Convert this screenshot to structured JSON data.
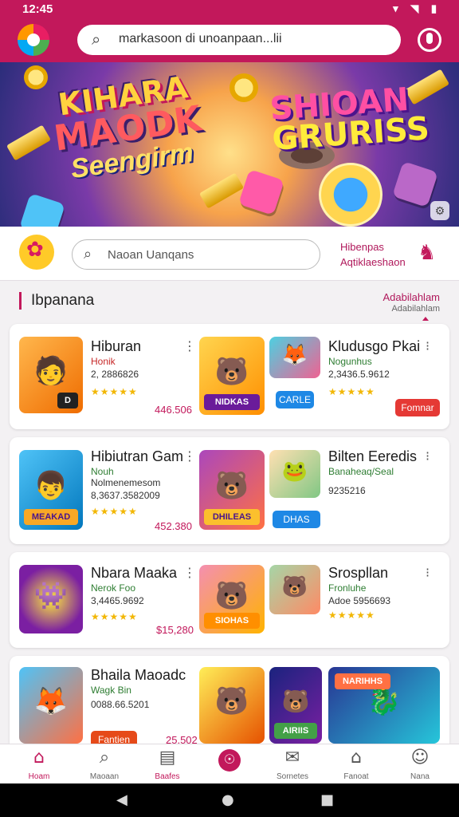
{
  "status_bar": {
    "time": "12:45",
    "icons": "▾ ◥ ▮"
  },
  "header": {
    "search_text": "markasoon di unoanpaan...lii"
  },
  "banner": {
    "left_logo": [
      "KIHARA",
      "MAODK",
      "Seengirm"
    ],
    "right_logo": [
      "SHIOAN",
      "GRURISS"
    ]
  },
  "sub_bar": {
    "search_placeholder": "Naoan Uanqans",
    "link_line1": "Hibenpas",
    "link_line2": "Aqtiklaeshaon"
  },
  "section": {
    "title": "Ibpanana",
    "link": "Adabilahlam",
    "link_sub": "Adabilahlam"
  },
  "cards": [
    {
      "left": {
        "name": "Hiburan",
        "category": "Honik",
        "meta": "2, 2886826",
        "stars": "★★★★★",
        "price": "446.506",
        "thumb_tag": "D"
      },
      "middle": {
        "thumb_tag": "NIDKAS"
      },
      "right": {
        "name": "Kludusgo Pkai",
        "category": "Nogunhus",
        "meta": "2,3436.5.9612",
        "stars": "★★★★★",
        "button": "Fomnar",
        "thumb_tag": "CARLE"
      }
    },
    {
      "left": {
        "name": "Hibiutran Gam",
        "category": "Nouh",
        "meta": "Nolmenemesom",
        "meta2": "8,3637.3582009",
        "stars": "★★★★★",
        "price": "452.380",
        "thumb_tag": "MEAKAD"
      },
      "middle": {
        "thumb_tag": "DHILEAS"
      },
      "right": {
        "name": "Bilten Eeredis",
        "category": "Banaheaq/Seal",
        "meta": "9235216",
        "button": "DHAS",
        "thumb_tag": ""
      }
    },
    {
      "left": {
        "name": "Nbara Maaka",
        "category": "Nerok Foo",
        "meta": "3,4465.9692",
        "stars": "★★★★★",
        "price": "$15,280",
        "thumb_tag": ""
      },
      "middle": {
        "thumb_tag": "SIOHAS"
      },
      "right": {
        "name": "Srospllan",
        "category": "Fronluhe",
        "meta": "Adoe 5956693",
        "stars": "★★★★★",
        "thumb_tag": ""
      }
    },
    {
      "left": {
        "name": "Bhaila Maoadc",
        "category": "Wagk Bin",
        "meta": "0088.66.5201",
        "button": "Fantien",
        "price": "25.502",
        "thumb_tag": ""
      },
      "middle": {
        "thumb_tag": "AIRIIS"
      },
      "right": {
        "thumb_tag": "NARIHHS"
      }
    }
  ],
  "bottom_nav": [
    {
      "label": "Hoam",
      "icon": "home-icon"
    },
    {
      "label": "Maoaan",
      "icon": "search-icon"
    },
    {
      "label": "Baafes",
      "icon": "list-icon"
    },
    {
      "label": "Sornetes",
      "icon": "chat-icon"
    },
    {
      "label": "Fanoat",
      "icon": "house-icon"
    },
    {
      "label": "Nana",
      "icon": "person-icon"
    }
  ],
  "colors": {
    "brand": "#c2185b",
    "star": "#f2b705",
    "category_red": "#c62828",
    "category_green": "#2e7d32"
  }
}
